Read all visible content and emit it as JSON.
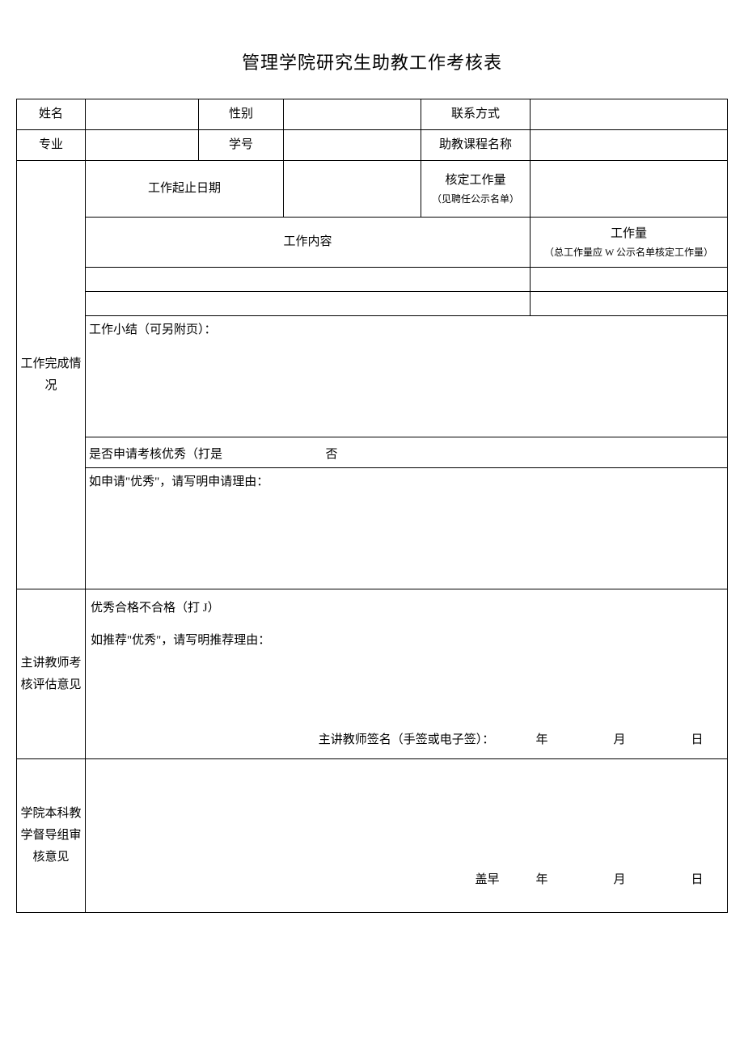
{
  "title": "管理学院研究生助教工作考核表",
  "row1": {
    "name": "姓名",
    "gender": "性别",
    "contact": "联系方式"
  },
  "row2": {
    "major": "专业",
    "sid": "学号",
    "course": "助教课程名称"
  },
  "row3": {
    "period": "工作起止日期",
    "workload": "核定工作量",
    "workload_note": "（见聘任公示名单）"
  },
  "row4": {
    "content": "工作内容",
    "total": "工作量",
    "total_note": "（总工作量应 W 公示名单核定工作量）"
  },
  "section_work": "工作完成情况",
  "summary_label": "工作小结（可另附页）：",
  "apply_excellent": "是否申请考核优秀（打是",
  "apply_fou": "否",
  "apply_reason": "如申请\"优秀\"，请写明申请理由：",
  "teacher_section": "主讲教师考核评估意见",
  "teacher_grade": "优秀合格不合格（打 J）",
  "teacher_recommend": "如推荐\"优秀\"，请写明推荐理由：",
  "teacher_sign": "主讲教师签名（手签或电子签）：",
  "committee_section": "学院本科教学督导组审核意见",
  "stamp": "盖早",
  "date": {
    "y": "年",
    "m": "月",
    "d": "日"
  }
}
